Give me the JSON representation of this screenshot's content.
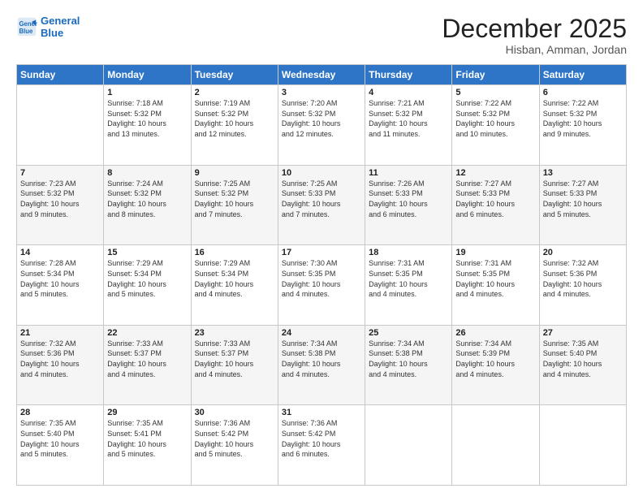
{
  "logo": {
    "line1": "General",
    "line2": "Blue"
  },
  "title": "December 2025",
  "subtitle": "Hisban, Amman, Jordan",
  "weekdays": [
    "Sunday",
    "Monday",
    "Tuesday",
    "Wednesday",
    "Thursday",
    "Friday",
    "Saturday"
  ],
  "weeks": [
    [
      {
        "day": "",
        "info": ""
      },
      {
        "day": "1",
        "info": "Sunrise: 7:18 AM\nSunset: 5:32 PM\nDaylight: 10 hours\nand 13 minutes."
      },
      {
        "day": "2",
        "info": "Sunrise: 7:19 AM\nSunset: 5:32 PM\nDaylight: 10 hours\nand 12 minutes."
      },
      {
        "day": "3",
        "info": "Sunrise: 7:20 AM\nSunset: 5:32 PM\nDaylight: 10 hours\nand 12 minutes."
      },
      {
        "day": "4",
        "info": "Sunrise: 7:21 AM\nSunset: 5:32 PM\nDaylight: 10 hours\nand 11 minutes."
      },
      {
        "day": "5",
        "info": "Sunrise: 7:22 AM\nSunset: 5:32 PM\nDaylight: 10 hours\nand 10 minutes."
      },
      {
        "day": "6",
        "info": "Sunrise: 7:22 AM\nSunset: 5:32 PM\nDaylight: 10 hours\nand 9 minutes."
      }
    ],
    [
      {
        "day": "7",
        "info": "Sunrise: 7:23 AM\nSunset: 5:32 PM\nDaylight: 10 hours\nand 9 minutes."
      },
      {
        "day": "8",
        "info": "Sunrise: 7:24 AM\nSunset: 5:32 PM\nDaylight: 10 hours\nand 8 minutes."
      },
      {
        "day": "9",
        "info": "Sunrise: 7:25 AM\nSunset: 5:32 PM\nDaylight: 10 hours\nand 7 minutes."
      },
      {
        "day": "10",
        "info": "Sunrise: 7:25 AM\nSunset: 5:33 PM\nDaylight: 10 hours\nand 7 minutes."
      },
      {
        "day": "11",
        "info": "Sunrise: 7:26 AM\nSunset: 5:33 PM\nDaylight: 10 hours\nand 6 minutes."
      },
      {
        "day": "12",
        "info": "Sunrise: 7:27 AM\nSunset: 5:33 PM\nDaylight: 10 hours\nand 6 minutes."
      },
      {
        "day": "13",
        "info": "Sunrise: 7:27 AM\nSunset: 5:33 PM\nDaylight: 10 hours\nand 5 minutes."
      }
    ],
    [
      {
        "day": "14",
        "info": "Sunrise: 7:28 AM\nSunset: 5:34 PM\nDaylight: 10 hours\nand 5 minutes."
      },
      {
        "day": "15",
        "info": "Sunrise: 7:29 AM\nSunset: 5:34 PM\nDaylight: 10 hours\nand 5 minutes."
      },
      {
        "day": "16",
        "info": "Sunrise: 7:29 AM\nSunset: 5:34 PM\nDaylight: 10 hours\nand 4 minutes."
      },
      {
        "day": "17",
        "info": "Sunrise: 7:30 AM\nSunset: 5:35 PM\nDaylight: 10 hours\nand 4 minutes."
      },
      {
        "day": "18",
        "info": "Sunrise: 7:31 AM\nSunset: 5:35 PM\nDaylight: 10 hours\nand 4 minutes."
      },
      {
        "day": "19",
        "info": "Sunrise: 7:31 AM\nSunset: 5:35 PM\nDaylight: 10 hours\nand 4 minutes."
      },
      {
        "day": "20",
        "info": "Sunrise: 7:32 AM\nSunset: 5:36 PM\nDaylight: 10 hours\nand 4 minutes."
      }
    ],
    [
      {
        "day": "21",
        "info": "Sunrise: 7:32 AM\nSunset: 5:36 PM\nDaylight: 10 hours\nand 4 minutes."
      },
      {
        "day": "22",
        "info": "Sunrise: 7:33 AM\nSunset: 5:37 PM\nDaylight: 10 hours\nand 4 minutes."
      },
      {
        "day": "23",
        "info": "Sunrise: 7:33 AM\nSunset: 5:37 PM\nDaylight: 10 hours\nand 4 minutes."
      },
      {
        "day": "24",
        "info": "Sunrise: 7:34 AM\nSunset: 5:38 PM\nDaylight: 10 hours\nand 4 minutes."
      },
      {
        "day": "25",
        "info": "Sunrise: 7:34 AM\nSunset: 5:38 PM\nDaylight: 10 hours\nand 4 minutes."
      },
      {
        "day": "26",
        "info": "Sunrise: 7:34 AM\nSunset: 5:39 PM\nDaylight: 10 hours\nand 4 minutes."
      },
      {
        "day": "27",
        "info": "Sunrise: 7:35 AM\nSunset: 5:40 PM\nDaylight: 10 hours\nand 4 minutes."
      }
    ],
    [
      {
        "day": "28",
        "info": "Sunrise: 7:35 AM\nSunset: 5:40 PM\nDaylight: 10 hours\nand 5 minutes."
      },
      {
        "day": "29",
        "info": "Sunrise: 7:35 AM\nSunset: 5:41 PM\nDaylight: 10 hours\nand 5 minutes."
      },
      {
        "day": "30",
        "info": "Sunrise: 7:36 AM\nSunset: 5:42 PM\nDaylight: 10 hours\nand 5 minutes."
      },
      {
        "day": "31",
        "info": "Sunrise: 7:36 AM\nSunset: 5:42 PM\nDaylight: 10 hours\nand 6 minutes."
      },
      {
        "day": "",
        "info": ""
      },
      {
        "day": "",
        "info": ""
      },
      {
        "day": "",
        "info": ""
      }
    ]
  ]
}
